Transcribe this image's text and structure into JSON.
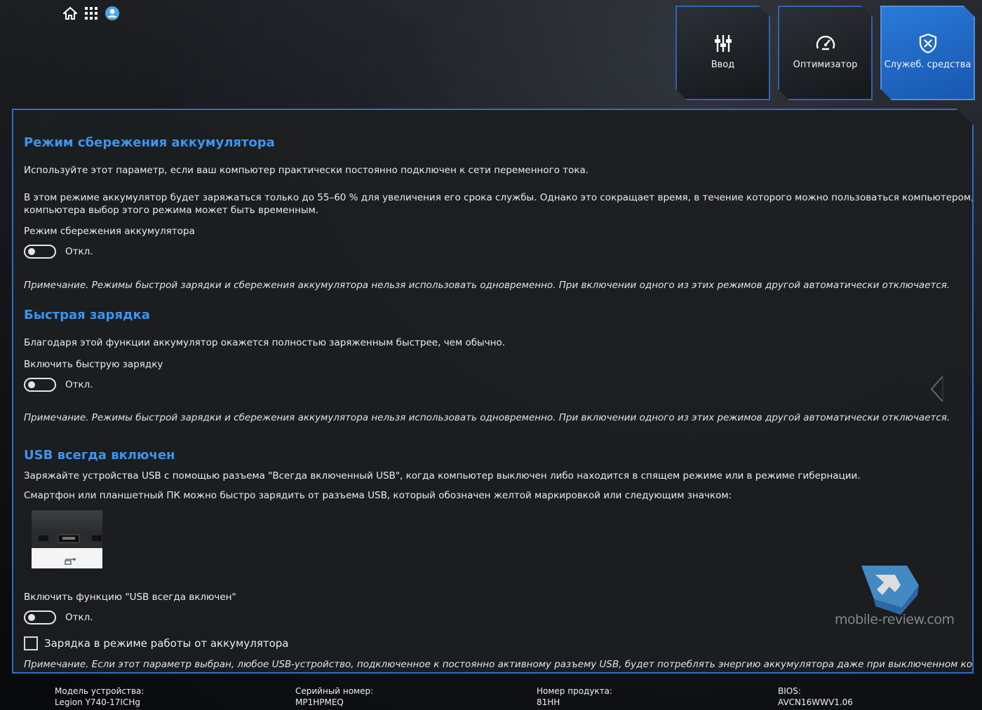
{
  "colors": {
    "accent": "#3d95ee",
    "tile_border": "#2f64b5",
    "tile_active": "#2a7ad8",
    "panel_border": "#2f6dc8"
  },
  "topbar": {
    "icons": [
      "home-icon",
      "apps-grid-icon",
      "account-icon"
    ]
  },
  "tiles": [
    {
      "label": "Ввод",
      "icon": "input-sliders-icon"
    },
    {
      "label": "Оптимизатор",
      "icon": "speedometer-icon"
    },
    {
      "label": "Служеб. средства",
      "icon": "tools-shield-icon"
    }
  ],
  "battery_saver": {
    "title": "Режим сбережения аккумулятора",
    "desc1": "Используйте этот параметр, если ваш компьютер практически постоянно подключен к сети переменного тока.",
    "desc2_line1": "В этом режиме аккумулятор будет заряжаться только до 55–60 % для увеличения его срока службы. Однако это сокращает время, в течение которого можно пользоваться компьютером, когда он от",
    "desc2_line2": "компьютера выбор этого режима может быть временным.",
    "toggle_caption": "Режим сбережения аккумулятора",
    "toggle_state": "Откл.",
    "note": "Примечание. Режимы быстрой зарядки и сбережения аккумулятора нельзя использовать одновременно. При включении одного из этих режимов другой автоматически отключается."
  },
  "rapid_charge": {
    "title": "Быстрая зарядка",
    "desc": "Благодаря этой функции аккумулятор окажется полностью заряженным быстрее, чем обычно.",
    "toggle_caption": "Включить быструю зарядку",
    "toggle_state": "Откл.",
    "note": "Примечание. Режимы быстрой зарядки и сбережения аккумулятора нельзя использовать одновременно. При включении одного из этих режимов другой автоматически отключается."
  },
  "usb_always_on": {
    "title": "USB всегда включен",
    "desc1": "Заряжайте устройства USB с помощью разъема \"Всегда включенный USB\", когда компьютер выключен либо находится в спящем режиме или в режиме гибернации.",
    "desc2": "Смартфон или планшетный ПК можно быстро зарядить от разъема USB, который обозначен желтой маркировкой или следующим значком:",
    "toggle_caption": "Включить функцию \"USB всегда включен\"",
    "toggle_state": "Откл.",
    "checkbox_label": "Зарядка в режиме работы от аккумулятора",
    "note": "Примечание. Если этот параметр выбран, любое USB-устройство, подключенное к постоянно активному разъему USB, будет потреблять энергию аккумулятора даже при выключенном компьютере. Ко"
  },
  "watermark": {
    "text": "mobile-review.com"
  },
  "footer": {
    "model_label": "Модель устройства:",
    "model_value": "Legion Y740-17ICHg",
    "serial_label": "Серийный номер:",
    "serial_value": "MP1HPMEQ",
    "product_label": "Номер продукта:",
    "product_value": "81HH",
    "bios_label": "BIOS:",
    "bios_value": "AVCN16WWV1.06"
  }
}
